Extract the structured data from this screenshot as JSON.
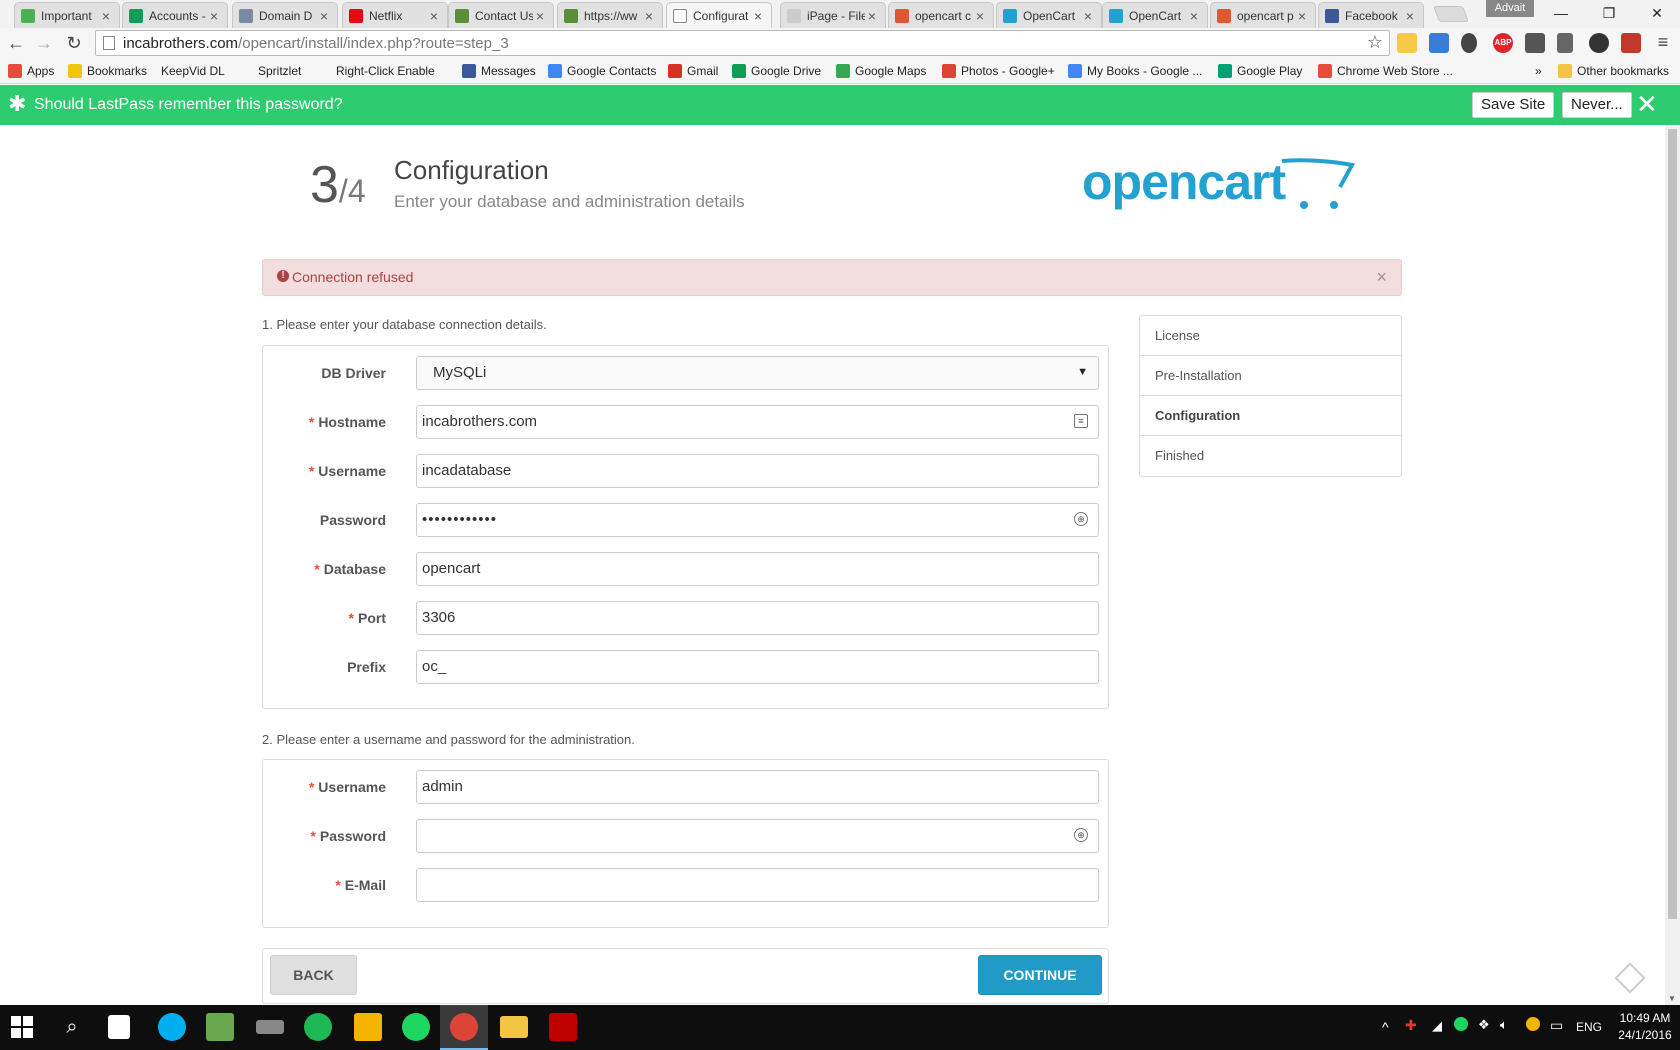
{
  "browser": {
    "tabs": [
      {
        "label": "Important",
        "favicon_color": "#4caf50"
      },
      {
        "label": "Accounts -",
        "favicon_color": "#0f9d58"
      },
      {
        "label": "Domain D",
        "favicon_color": "#7a8aa0"
      },
      {
        "label": "Netflix",
        "favicon_color": "#e50914"
      },
      {
        "label": "Contact Us",
        "favicon_color": "#5a8f3a"
      },
      {
        "label": "https://ww",
        "favicon_color": "#5a8f3a"
      },
      {
        "label": "Configurat",
        "favicon_color": "#ffffff"
      },
      {
        "label": "iPage - File",
        "favicon_color": "#cccccc"
      },
      {
        "label": "opencart c",
        "favicon_color": "#de5833"
      },
      {
        "label": "OpenCart",
        "favicon_color": "#23a1d1"
      },
      {
        "label": "OpenCart",
        "favicon_color": "#23a1d1"
      },
      {
        "label": "opencart p",
        "favicon_color": "#de5833"
      },
      {
        "label": "Facebook",
        "favicon_color": "#3b5998"
      }
    ],
    "active_tab": 6,
    "profile_name": "Advait",
    "url_host": "incabrothers.com",
    "url_path": "/opencart/install/index.php?route=step_3",
    "bookmarks": [
      {
        "label": "Apps",
        "icon": "apps-grid-icon",
        "color": "#e74c3c"
      },
      {
        "label": "Bookmarks",
        "icon": "star-icon",
        "color": "#f1c40f"
      },
      {
        "label": "KeepVid DL",
        "icon": "page-icon",
        "color": "#ffffff"
      },
      {
        "label": "Spritzlet",
        "icon": "page-icon",
        "color": "#ffffff"
      },
      {
        "label": "Right-Click Enable",
        "icon": "page-icon",
        "color": "#ffffff"
      },
      {
        "label": "Messages",
        "icon": "facebook-icon",
        "color": "#3b5998"
      },
      {
        "label": "Google Contacts",
        "icon": "contacts-icon",
        "color": "#4285f4"
      },
      {
        "label": "Gmail",
        "icon": "gmail-icon",
        "color": "#d93025"
      },
      {
        "label": "Google Drive",
        "icon": "drive-icon",
        "color": "#0f9d58"
      },
      {
        "label": "Google Maps",
        "icon": "maps-icon",
        "color": "#34a853"
      },
      {
        "label": "Photos - Google+",
        "icon": "photos-icon",
        "color": "#db4437"
      },
      {
        "label": "My Books - Google ...",
        "icon": "play-books-icon",
        "color": "#4285f4"
      },
      {
        "label": "Google Play",
        "icon": "play-icon",
        "color": "#00a173"
      },
      {
        "label": "Chrome Web Store ...",
        "icon": "webstore-icon",
        "color": "#e74c3c"
      }
    ],
    "bookmarks_overflow": "»",
    "other_bookmarks": "Other bookmarks"
  },
  "lastpass": {
    "message": "Should LastPass remember this password?",
    "save_label": "Save Site",
    "never_label": "Never...",
    "accent": "#2ecc71"
  },
  "header": {
    "step_current": "3",
    "step_total": "/4",
    "title": "Configuration",
    "subtitle": "Enter your database and administration details",
    "logo_text": "opencart"
  },
  "alert": {
    "message": "Connection refused",
    "close": "×"
  },
  "db_section": {
    "legend": "1. Please enter your database connection details.",
    "fields": [
      {
        "label": "DB Driver",
        "required": false,
        "value": "MySQLi",
        "type": "select"
      },
      {
        "label": "Hostname",
        "required": true,
        "value": "incabrothers.com",
        "type": "text"
      },
      {
        "label": "Username",
        "required": true,
        "value": "incadatabase",
        "type": "text"
      },
      {
        "label": "Password",
        "required": false,
        "value": "••••••••••••",
        "type": "password"
      },
      {
        "label": "Database",
        "required": true,
        "value": "opencart",
        "type": "text"
      },
      {
        "label": "Port",
        "required": true,
        "value": "3306",
        "type": "text"
      },
      {
        "label": "Prefix",
        "required": false,
        "value": "oc_",
        "type": "text"
      }
    ]
  },
  "admin_section": {
    "legend": "2. Please enter a username and password for the administration.",
    "fields": [
      {
        "label": "Username",
        "required": true,
        "value": "admin",
        "type": "text"
      },
      {
        "label": "Password",
        "required": true,
        "value": "",
        "type": "password"
      },
      {
        "label": "E-Mail",
        "required": true,
        "value": "",
        "type": "text"
      }
    ]
  },
  "sidebar": {
    "items": [
      {
        "label": "License",
        "active": false
      },
      {
        "label": "Pre-Installation",
        "active": false
      },
      {
        "label": "Configuration",
        "active": true
      },
      {
        "label": "Finished",
        "active": false
      }
    ]
  },
  "actions": {
    "back_label": "BACK",
    "continue_label": "CONTINUE"
  },
  "taskbar": {
    "language": "ENG",
    "time": "10:49 AM",
    "date": "24/1/2016"
  }
}
